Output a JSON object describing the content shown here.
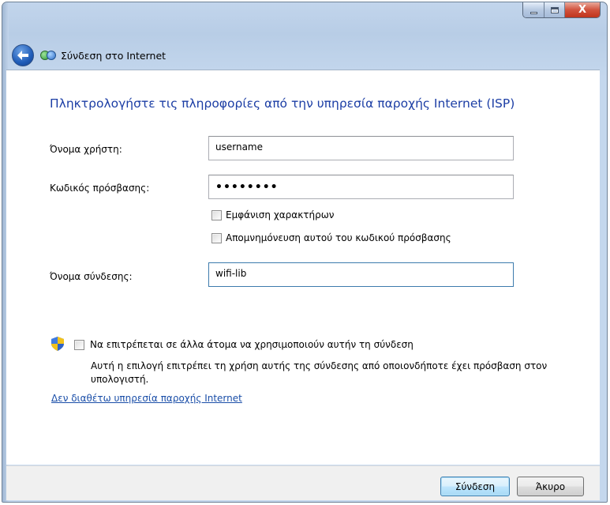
{
  "window": {
    "title": "Σύνδεση στο Internet"
  },
  "heading": "Πληκτρολογήστε τις πληροφορίες από την υπηρεσία παροχής Internet (ISP)",
  "form": {
    "username_label": "Όνομα χρήστη:",
    "username_value": "username",
    "password_label": "Κωδικός πρόσβασης:",
    "password_value": "••••••••",
    "show_chars_label": "Εμφάνιση χαρακτήρων",
    "remember_label": "Απομνημόνευση αυτού του κωδικού πρόσβασης",
    "connection_name_label": "Όνομα σύνδεσης:",
    "connection_name_value": "wifi-lib"
  },
  "sharing": {
    "allow_label": "Να επιτρέπεται σε άλλα άτομα να χρησιμοποιούν αυτήν τη σύνδεση",
    "description": "Αυτή η επιλογή επιτρέπει τη χρήση αυτής της σύνδεσης από οποιονδήποτε έχει πρόσβαση στον υπολογιστή."
  },
  "link_no_isp": "Δεν διαθέτω υπηρεσία παροχής Internet",
  "buttons": {
    "connect": "Σύνδεση",
    "cancel": "Άκυρο"
  },
  "caption_buttons": {
    "close_glyph": "X"
  },
  "icons": {
    "back": "back-arrow-icon",
    "network": "network-globe-icon",
    "shield": "uac-shield-icon"
  },
  "colors": {
    "heading": "#1c3ea5",
    "link": "#1a4ea8",
    "title_bar": "#c2d5ec",
    "focus_border": "#3d7bad"
  }
}
